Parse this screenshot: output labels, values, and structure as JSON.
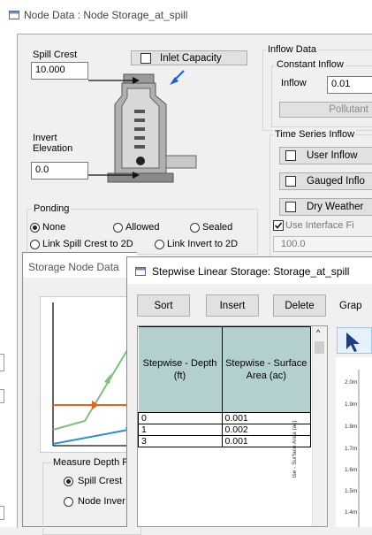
{
  "node_window": {
    "title": "Node Data : Node Storage_at_spill",
    "spill_crest_label": "Spill Crest",
    "spill_crest_value": "10.000",
    "inlet_capacity_label": "Inlet Capacity",
    "invert_elevation_label": "Invert\nElevation",
    "invert_value": "0.0",
    "ponding_title": "Ponding",
    "ponding_none": "None",
    "ponding_allowed": "Allowed",
    "ponding_sealed": "Sealed",
    "link_spill_label": "Link Spill Crest to 2D",
    "link_invert_label": "Link Invert to 2D",
    "inflow_title": "Inflow Data",
    "constant_inflow_title": "Constant Inflow",
    "inflow_label": "Inflow",
    "inflow_value": "0.01",
    "pollutant_button": "Pollutant Lo",
    "time_series_title": "Time Series Inflow",
    "user_inflow_label": "User Inflow",
    "gauged_inflow_label": "Gauged Inflo",
    "dry_weather_label": "Dry Weather",
    "use_interface_label": "Use Interface Fi",
    "interface_value": "100.0"
  },
  "storage_window": {
    "title": "Storage Node Data",
    "measure_depth_title": "Measure Depth Fi",
    "spill_crest_option": "Spill Crest",
    "node_invert_option": "Node Inver"
  },
  "stepwise_window": {
    "title": "Stepwise Linear Storage: Storage_at_spill",
    "sort_button": "Sort",
    "insert_button": "Insert",
    "delete_button": "Delete",
    "graph_label": "Grap",
    "col_depth_header": "Stepwise - Depth (ft)",
    "col_area_header": "Stepwise - Surface Area (ac)",
    "rows": [
      {
        "depth": "0",
        "area": "0.001"
      },
      {
        "depth": "1",
        "area": "0.002"
      },
      {
        "depth": "3",
        "area": "0.001"
      }
    ],
    "graph_ylabel": "ise - Surface Area (ac)",
    "graph_ticks": [
      "2.0m",
      "1.9m",
      "1.8m",
      "1.7m",
      "1.6m",
      "1.5m",
      "1.4m"
    ]
  },
  "colors": {
    "header_teal": "#b3cfcf",
    "arrow_blue": "#1f5fd0",
    "line_green": "#7dc27a",
    "line_orange": "#e8641e",
    "line_blue": "#2a8fd4"
  }
}
